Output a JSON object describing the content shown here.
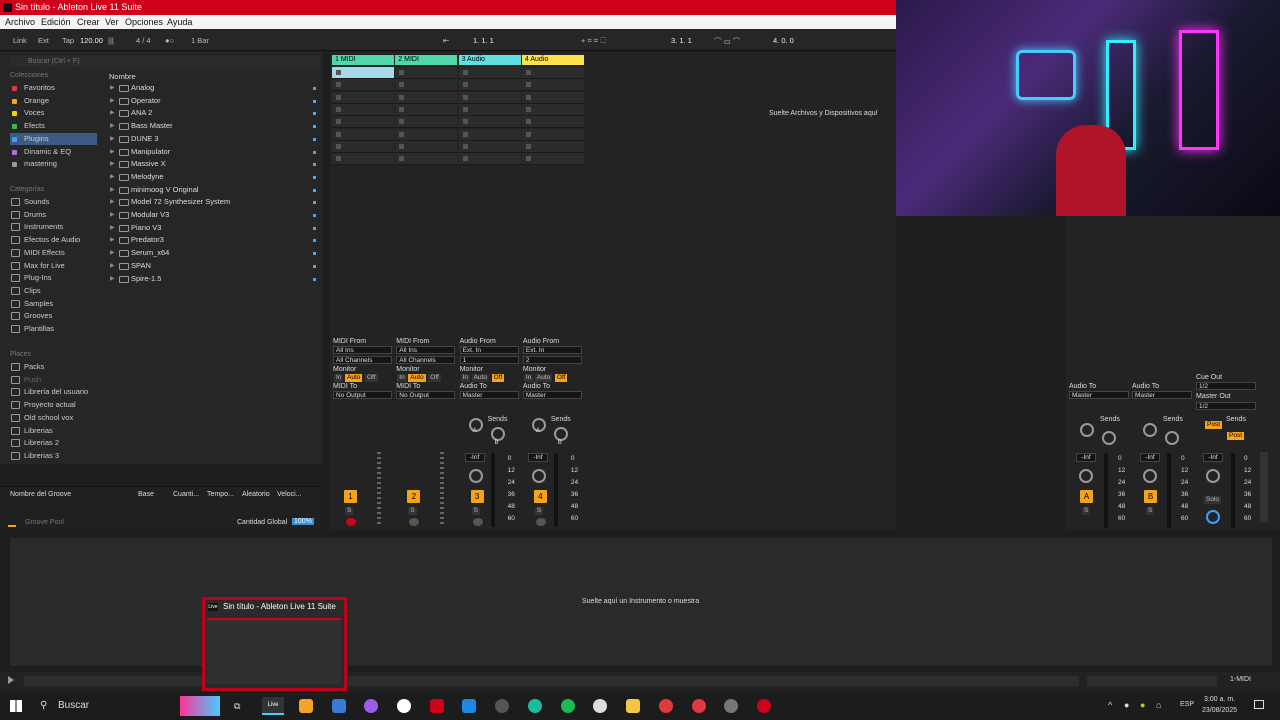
{
  "window": {
    "title": "Sin título - Ableton Live 11 Suite"
  },
  "menu": [
    "Archivo",
    "Edición",
    "Crear",
    "Ver",
    "Opciones",
    "Ayuda"
  ],
  "transport": {
    "link": "Link",
    "ext": "Ext",
    "tap": "Tap",
    "tempo": "120.00",
    "time_sig": "4 / 4",
    "quant": "1 Bar",
    "position": "1.  1.  1",
    "loop_start": "3.  1.  1",
    "loop_len": "4.  0.  0"
  },
  "browser": {
    "search_placeholder": "Buscar (Ctrl + F)",
    "collections_label": "Colecciones",
    "collections": [
      {
        "label": "Favoritos",
        "color": "#e0393e"
      },
      {
        "label": "Orange",
        "color": "#f6a21a"
      },
      {
        "label": "Voces",
        "color": "#f2d200"
      },
      {
        "label": "Efects",
        "color": "#2fbf4a"
      },
      {
        "label": "Plugins",
        "color": "#3aa0ff"
      },
      {
        "label": "Dinamic & EQ",
        "color": "#b06ee0"
      },
      {
        "label": "mastering",
        "color": "#999999"
      }
    ],
    "categories_label": "Categorías",
    "categories": [
      "Sounds",
      "Drums",
      "Instruments",
      "Efectos de Audio",
      "MIDI Effects",
      "Max for Live",
      "Plug-Ins",
      "Clips",
      "Samples",
      "Grooves",
      "Plantillas"
    ],
    "places_label": "Places",
    "places": [
      "Packs",
      "Push",
      "Librería del usuario",
      "Proyecto actual",
      "Old school vox",
      "Librerias",
      "Librerias 2",
      "Librerias 3"
    ],
    "name_header": "Nombre",
    "files": [
      "Analog",
      "Operator",
      "ANA 2",
      "Bass Master",
      "DUNE 3",
      "Manipulator",
      "Massive X",
      "Melodyne",
      "minimoog V Original",
      "Model 72 Synthesizer System",
      "Modular V3",
      "Piano V3",
      "Predator3",
      "Serum_x64",
      "SPAN",
      "Spire-1.5"
    ]
  },
  "groove": {
    "headers": [
      "Nombre del Groove",
      "Base",
      "Cuanti...",
      "Tempo...",
      "Aleatorio",
      "Veloci..."
    ],
    "pool": "Groove Pool",
    "global": "Cantidad Global",
    "global_val": "100%"
  },
  "session": {
    "tracks": [
      {
        "name": "1 MIDI",
        "color": "#4fd9a6"
      },
      {
        "name": "2 MIDI",
        "color": "#4fd9a6"
      },
      {
        "name": "3 Audio",
        "color": "#5fe0e0"
      },
      {
        "name": "4 Audio",
        "color": "#ffe34d"
      }
    ],
    "drop_hint": "Suelte Archivos y Dispositivos aquí",
    "io": [
      {
        "from_label": "MIDI From",
        "from": "All Ins",
        "ch": "All Channels",
        "to_label": "MIDI To",
        "to": "No Output",
        "num": "1"
      },
      {
        "from_label": "MIDI From",
        "from": "All Ins",
        "ch": "All Channels",
        "to_label": "MIDI To",
        "to": "No Output",
        "num": "2"
      },
      {
        "from_label": "Audio From",
        "from": "Ext. In",
        "ch": "1",
        "to_label": "Audio To",
        "to": "Master",
        "num": "3"
      },
      {
        "from_label": "Audio From",
        "from": "Ext. In",
        "ch": "2",
        "to_label": "Audio To",
        "to": "Master",
        "num": "4"
      }
    ],
    "monitor_label": "Monitor",
    "mon_in": "In",
    "mon_auto": "Auto",
    "mon_off": "Off",
    "sends": "Sends",
    "send_a": "A",
    "send_b": "B",
    "vol": "-Inf",
    "solo": "S",
    "scale": [
      "0",
      "12",
      "24",
      "36",
      "48",
      "60"
    ]
  },
  "returns": {
    "audio_to": "Audio To",
    "master": "Master",
    "a": "A",
    "b": "B",
    "cue_out": "Cue Out",
    "cue_val": "1/2",
    "master_out": "Master Out",
    "master_val": "1/2",
    "post": "Post",
    "solo": "Solo"
  },
  "detail": {
    "hint": "Suelte aquí un Instrumento o muestra"
  },
  "status": {
    "track": "1-MIDI"
  },
  "taskbar": {
    "search": "Buscar",
    "lang": "ESP",
    "time": "3:00 a. m.",
    "date": "23/08/2025",
    "live": "Live"
  },
  "thumbnail": {
    "title": "Sin título - Ableton Live 11 Suite"
  }
}
